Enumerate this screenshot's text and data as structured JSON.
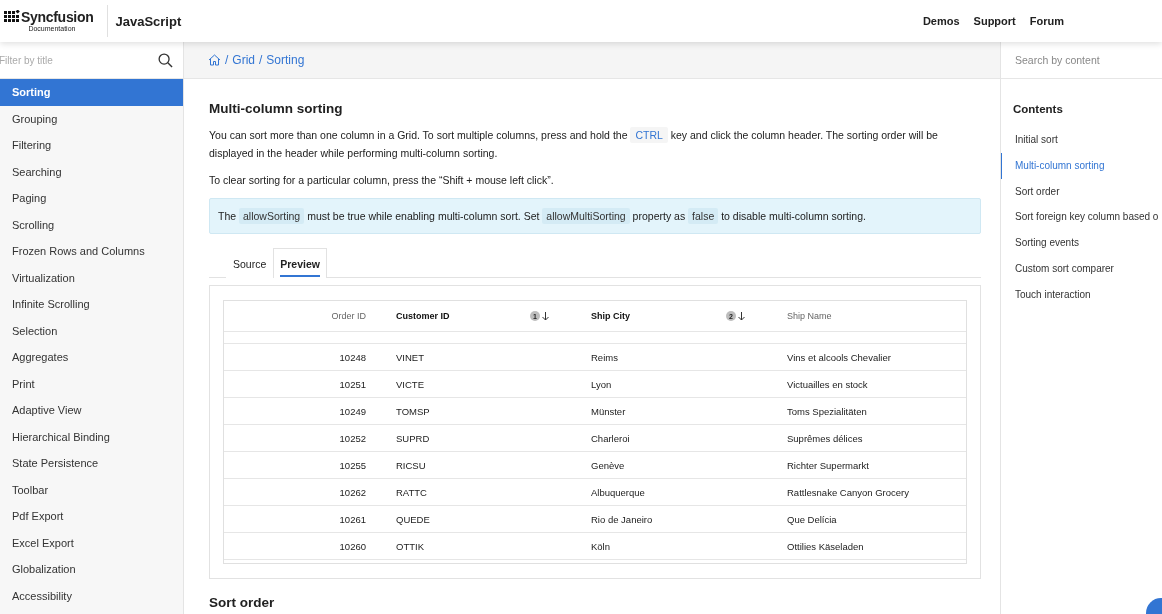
{
  "header": {
    "logo": {
      "name": "Syncfusion",
      "sub": "Documentation"
    },
    "product": "JavaScript",
    "links": [
      "Demos",
      "Support",
      "Forum"
    ]
  },
  "sidebar": {
    "filter": {
      "placeholder": "Filter by title"
    },
    "items": [
      {
        "label": "Sorting",
        "selected": true
      },
      {
        "label": "Grouping",
        "selected": false
      },
      {
        "label": "Filtering",
        "selected": false
      },
      {
        "label": "Searching",
        "selected": false
      },
      {
        "label": "Paging",
        "selected": false
      },
      {
        "label": "Scrolling",
        "selected": false
      },
      {
        "label": "Frozen Rows and Columns",
        "selected": false
      },
      {
        "label": "Virtualization",
        "selected": false
      },
      {
        "label": "Infinite Scrolling",
        "selected": false
      },
      {
        "label": "Selection",
        "selected": false
      },
      {
        "label": "Aggregates",
        "selected": false
      },
      {
        "label": "Print",
        "selected": false
      },
      {
        "label": "Adaptive View",
        "selected": false
      },
      {
        "label": "Hierarchical Binding",
        "selected": false
      },
      {
        "label": "State Persistence",
        "selected": false
      },
      {
        "label": "Toolbar",
        "selected": false
      },
      {
        "label": "Pdf Export",
        "selected": false
      },
      {
        "label": "Excel Export",
        "selected": false
      },
      {
        "label": "Globalization",
        "selected": false
      },
      {
        "label": "Accessibility",
        "selected": false
      }
    ]
  },
  "breadcrumb": {
    "separator": "/",
    "items": [
      "Grid",
      "Sorting"
    ]
  },
  "article": {
    "heading": "Multi-column sorting",
    "paragraphs": [
      [
        {
          "kind": "text",
          "text": "You can sort more than one column in a Grid. To sort multiple columns, press and hold the "
        },
        {
          "kind": "key",
          "text": "CTRL"
        },
        {
          "kind": "text",
          "text": " key and click the column header. The sorting order will be displayed in the header while performing multi-column sorting."
        }
      ],
      [
        {
          "kind": "text",
          "text": "To clear sorting for a particular column, press the “Shift + mouse left click”."
        }
      ]
    ],
    "note": [
      {
        "kind": "text",
        "text": "The "
      },
      {
        "kind": "code",
        "text": "allowSorting"
      },
      {
        "kind": "text",
        "text": " must be true while enabling multi-column sort. Set "
      },
      {
        "kind": "code",
        "text": "allowMultiSorting"
      },
      {
        "kind": "text",
        "text": " property as "
      },
      {
        "kind": "code",
        "text": "false"
      },
      {
        "kind": "text",
        "text": " to disable multi-column sorting."
      }
    ],
    "tabs": [
      {
        "label": "Source",
        "selected": false
      },
      {
        "label": "Preview",
        "selected": true
      }
    ],
    "grid": {
      "columns": [
        {
          "label": "Order ID",
          "bold": false,
          "kind": "number"
        },
        {
          "label": "Customer ID",
          "bold": true,
          "kind": "text",
          "sort_order": "1"
        },
        {
          "label": "Ship City",
          "bold": true,
          "kind": "text",
          "sort_order": "2"
        },
        {
          "label": "Ship Name",
          "bold": false,
          "kind": "text"
        }
      ],
      "rows": [
        [
          "10248",
          "VINET",
          "Reims",
          "Vins et alcools Chevalier"
        ],
        [
          "10251",
          "VICTE",
          "Lyon",
          "Victuailles en stock"
        ],
        [
          "10249",
          "TOMSP",
          "Münster",
          "Toms Spezialitäten"
        ],
        [
          "10252",
          "SUPRD",
          "Charleroi",
          "Suprêmes délices"
        ],
        [
          "10255",
          "RICSU",
          "Genève",
          "Richter Supermarkt"
        ],
        [
          "10262",
          "RATTC",
          "Albuquerque",
          "Rattlesnake Canyon Grocery"
        ],
        [
          "10261",
          "QUEDE",
          "Rio de Janeiro",
          "Que Delícia"
        ],
        [
          "10260",
          "OTTIK",
          "Köln",
          "Ottilies Käseladen"
        ]
      ]
    },
    "next_heading": "Sort order"
  },
  "right_panel": {
    "search": {
      "placeholder": "Search by content"
    },
    "title": "Contents",
    "items": [
      {
        "label": "Initial sort",
        "selected": false
      },
      {
        "label": "Multi-column sorting",
        "selected": true
      },
      {
        "label": "Sort order",
        "selected": false
      },
      {
        "label": "Sort foreign key column based o",
        "selected": false
      },
      {
        "label": "Sorting events",
        "selected": false
      },
      {
        "label": "Custom sort comparer",
        "selected": false
      },
      {
        "label": "Touch interaction",
        "selected": false
      }
    ]
  }
}
